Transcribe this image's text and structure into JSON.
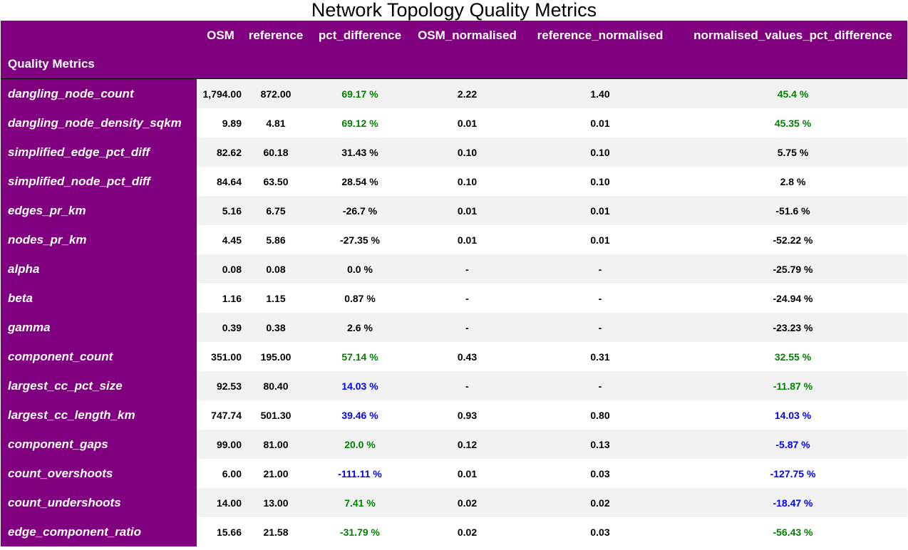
{
  "title": "Network Topology Quality Metrics",
  "header": {
    "index_name": "Quality Metrics",
    "columns": [
      "OSM",
      "reference",
      "pct_difference",
      "OSM_normalised",
      "reference_normalised",
      "normalised_values_pct_difference"
    ]
  },
  "colors": {
    "header_bg": "#800080",
    "green": "#008000",
    "blue": "#0000ff",
    "stripe": "#f2f2f2"
  },
  "rows": [
    {
      "label": "dangling_node_count",
      "osm": "1,794.00",
      "reference": "872.00",
      "pct_difference": "69.17 %",
      "pct_color": "green",
      "osm_normalised": "2.22",
      "reference_normalised": "1.40",
      "norm_pct_difference": "45.4 %",
      "norm_color": "green"
    },
    {
      "label": "dangling_node_density_sqkm",
      "osm": "9.89",
      "reference": "4.81",
      "pct_difference": "69.12 %",
      "pct_color": "green",
      "osm_normalised": "0.01",
      "reference_normalised": "0.01",
      "norm_pct_difference": "45.35 %",
      "norm_color": "green"
    },
    {
      "label": "simplified_edge_pct_diff",
      "osm": "82.62",
      "reference": "60.18",
      "pct_difference": "31.43 %",
      "pct_color": "black",
      "osm_normalised": "0.10",
      "reference_normalised": "0.10",
      "norm_pct_difference": "5.75 %",
      "norm_color": "black"
    },
    {
      "label": "simplified_node_pct_diff",
      "osm": "84.64",
      "reference": "63.50",
      "pct_difference": "28.54 %",
      "pct_color": "black",
      "osm_normalised": "0.10",
      "reference_normalised": "0.10",
      "norm_pct_difference": "2.8 %",
      "norm_color": "black"
    },
    {
      "label": "edges_pr_km",
      "osm": "5.16",
      "reference": "6.75",
      "pct_difference": "-26.7 %",
      "pct_color": "black",
      "osm_normalised": "0.01",
      "reference_normalised": "0.01",
      "norm_pct_difference": "-51.6 %",
      "norm_color": "black"
    },
    {
      "label": "nodes_pr_km",
      "osm": "4.45",
      "reference": "5.86",
      "pct_difference": "-27.35 %",
      "pct_color": "black",
      "osm_normalised": "0.01",
      "reference_normalised": "0.01",
      "norm_pct_difference": "-52.22 %",
      "norm_color": "black"
    },
    {
      "label": "alpha",
      "osm": "0.08",
      "reference": "0.08",
      "pct_difference": "0.0 %",
      "pct_color": "black",
      "osm_normalised": "-",
      "reference_normalised": "-",
      "norm_pct_difference": "-25.79 %",
      "norm_color": "black"
    },
    {
      "label": "beta",
      "osm": "1.16",
      "reference": "1.15",
      "pct_difference": "0.87 %",
      "pct_color": "black",
      "osm_normalised": "-",
      "reference_normalised": "-",
      "norm_pct_difference": "-24.94 %",
      "norm_color": "black"
    },
    {
      "label": "gamma",
      "osm": "0.39",
      "reference": "0.38",
      "pct_difference": "2.6 %",
      "pct_color": "black",
      "osm_normalised": "-",
      "reference_normalised": "-",
      "norm_pct_difference": "-23.23 %",
      "norm_color": "black"
    },
    {
      "label": "component_count",
      "osm": "351.00",
      "reference": "195.00",
      "pct_difference": "57.14 %",
      "pct_color": "green",
      "osm_normalised": "0.43",
      "reference_normalised": "0.31",
      "norm_pct_difference": "32.55 %",
      "norm_color": "green"
    },
    {
      "label": "largest_cc_pct_size",
      "osm": "92.53",
      "reference": "80.40",
      "pct_difference": "14.03 %",
      "pct_color": "blue",
      "osm_normalised": "-",
      "reference_normalised": "-",
      "norm_pct_difference": "-11.87 %",
      "norm_color": "green"
    },
    {
      "label": "largest_cc_length_km",
      "osm": "747.74",
      "reference": "501.30",
      "pct_difference": "39.46 %",
      "pct_color": "blue",
      "osm_normalised": "0.93",
      "reference_normalised": "0.80",
      "norm_pct_difference": "14.03 %",
      "norm_color": "blue"
    },
    {
      "label": "component_gaps",
      "osm": "99.00",
      "reference": "81.00",
      "pct_difference": "20.0 %",
      "pct_color": "green",
      "osm_normalised": "0.12",
      "reference_normalised": "0.13",
      "norm_pct_difference": "-5.87 %",
      "norm_color": "blue"
    },
    {
      "label": "count_overshoots",
      "osm": "6.00",
      "reference": "21.00",
      "pct_difference": "-111.11 %",
      "pct_color": "blue",
      "osm_normalised": "0.01",
      "reference_normalised": "0.03",
      "norm_pct_difference": "-127.75 %",
      "norm_color": "blue"
    },
    {
      "label": "count_undershoots",
      "osm": "14.00",
      "reference": "13.00",
      "pct_difference": "7.41 %",
      "pct_color": "green",
      "osm_normalised": "0.02",
      "reference_normalised": "0.02",
      "norm_pct_difference": "-18.47 %",
      "norm_color": "blue"
    },
    {
      "label": "edge_component_ratio",
      "osm": "15.66",
      "reference": "21.58",
      "pct_difference": "-31.79 %",
      "pct_color": "green",
      "osm_normalised": "0.02",
      "reference_normalised": "0.03",
      "norm_pct_difference": "-56.43 %",
      "norm_color": "green"
    }
  ]
}
